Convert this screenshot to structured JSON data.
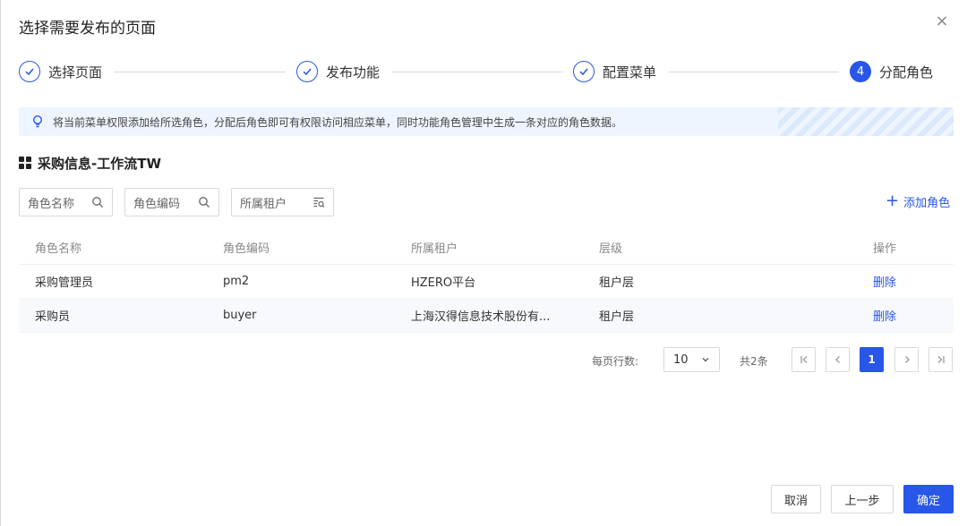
{
  "dialog": {
    "title": "选择需要发布的页面",
    "close_glyph": "×"
  },
  "steps": [
    {
      "number": "1",
      "label": "选择页面",
      "status": "done"
    },
    {
      "number": "2",
      "label": "发布功能",
      "status": "done"
    },
    {
      "number": "3",
      "label": "配置菜单",
      "status": "done"
    },
    {
      "number": "4",
      "label": "分配角色",
      "status": "active"
    }
  ],
  "alert": {
    "text": "将当前菜单权限添加给所选角色，分配后角色即可有权限访问相应菜单，同时功能角色管理中生成一条对应的角色数据。"
  },
  "section": {
    "title": "采购信息-工作流TW"
  },
  "filters": {
    "role_name": "角色名称",
    "role_code": "角色编码",
    "tenant": "所属租户"
  },
  "actions": {
    "add_role_icon": "+",
    "add_role": "添加角色"
  },
  "table": {
    "headers": [
      "角色名称",
      "角色编码",
      "所属租户",
      "层级",
      "操作"
    ],
    "rows": [
      {
        "name": "采购管理员",
        "code": "pm2",
        "tenant": "HZERO平台",
        "level": "租户层",
        "op": "删除"
      },
      {
        "name": "采购员",
        "code": "buyer",
        "tenant": "上海汉得信息技术股份有...",
        "level": "租户层",
        "op": "删除"
      }
    ]
  },
  "pagination": {
    "rows_per_page_label": "每页行数:",
    "page_size": "10",
    "total": "共2条",
    "current_page": "1"
  },
  "footer": {
    "cancel": "取消",
    "prev": "上一步",
    "confirm": "确定"
  },
  "colors": {
    "primary": "#2756e8",
    "alert_bg": "#eef5ff"
  }
}
